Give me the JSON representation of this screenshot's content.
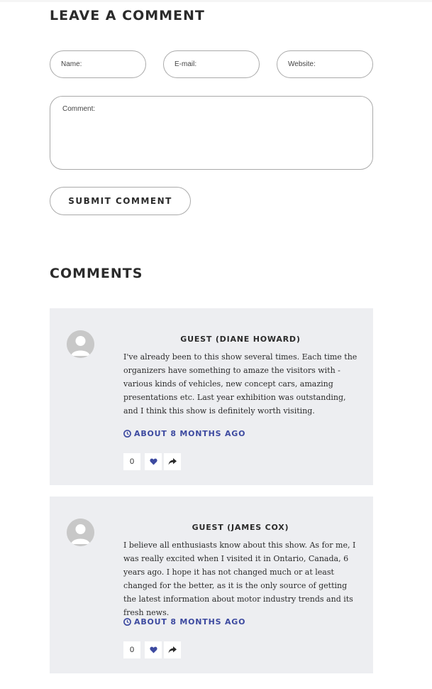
{
  "leave_comment": {
    "title": "LEAVE A COMMENT",
    "name_placeholder": "Name:",
    "email_placeholder": "E-mail:",
    "website_placeholder": "Website:",
    "comment_placeholder": "Comment:",
    "submit_label": "SUBMIT COMMENT"
  },
  "comments_section": {
    "title": "COMMENTS",
    "items": [
      {
        "author": "GUEST (DIANE HOWARD)",
        "text": "I've already been to this show several times. Each time the organizers have something to amaze the visitors with - various kinds of vehicles, new concept cars, amazing presentations etc. Last year exhibition was outstanding, and I think this show is definitely worth visiting.",
        "time": "ABOUT 8 MONTHS AGO",
        "likes": "0"
      },
      {
        "author": "GUEST (JAMES COX)",
        "text": "I believe all enthusiasts know about this show. As for me, I was really excited when I visited it in Ontario, Canada, 6 years ago. I hope it has not changed much or at least changed for the better, as it is the only source of getting the latest information about motor industry trends and its fresh news.",
        "time": "ABOUT 8 MONTHS AGO",
        "likes": "0"
      }
    ]
  },
  "colors": {
    "accent": "#3d4aa0",
    "card_background": "#edeef1",
    "heading": "#2b2b2b"
  },
  "icons": {
    "time": "clock-icon",
    "like": "heart-icon",
    "share": "share-icon",
    "avatar": "user-avatar-icon"
  }
}
